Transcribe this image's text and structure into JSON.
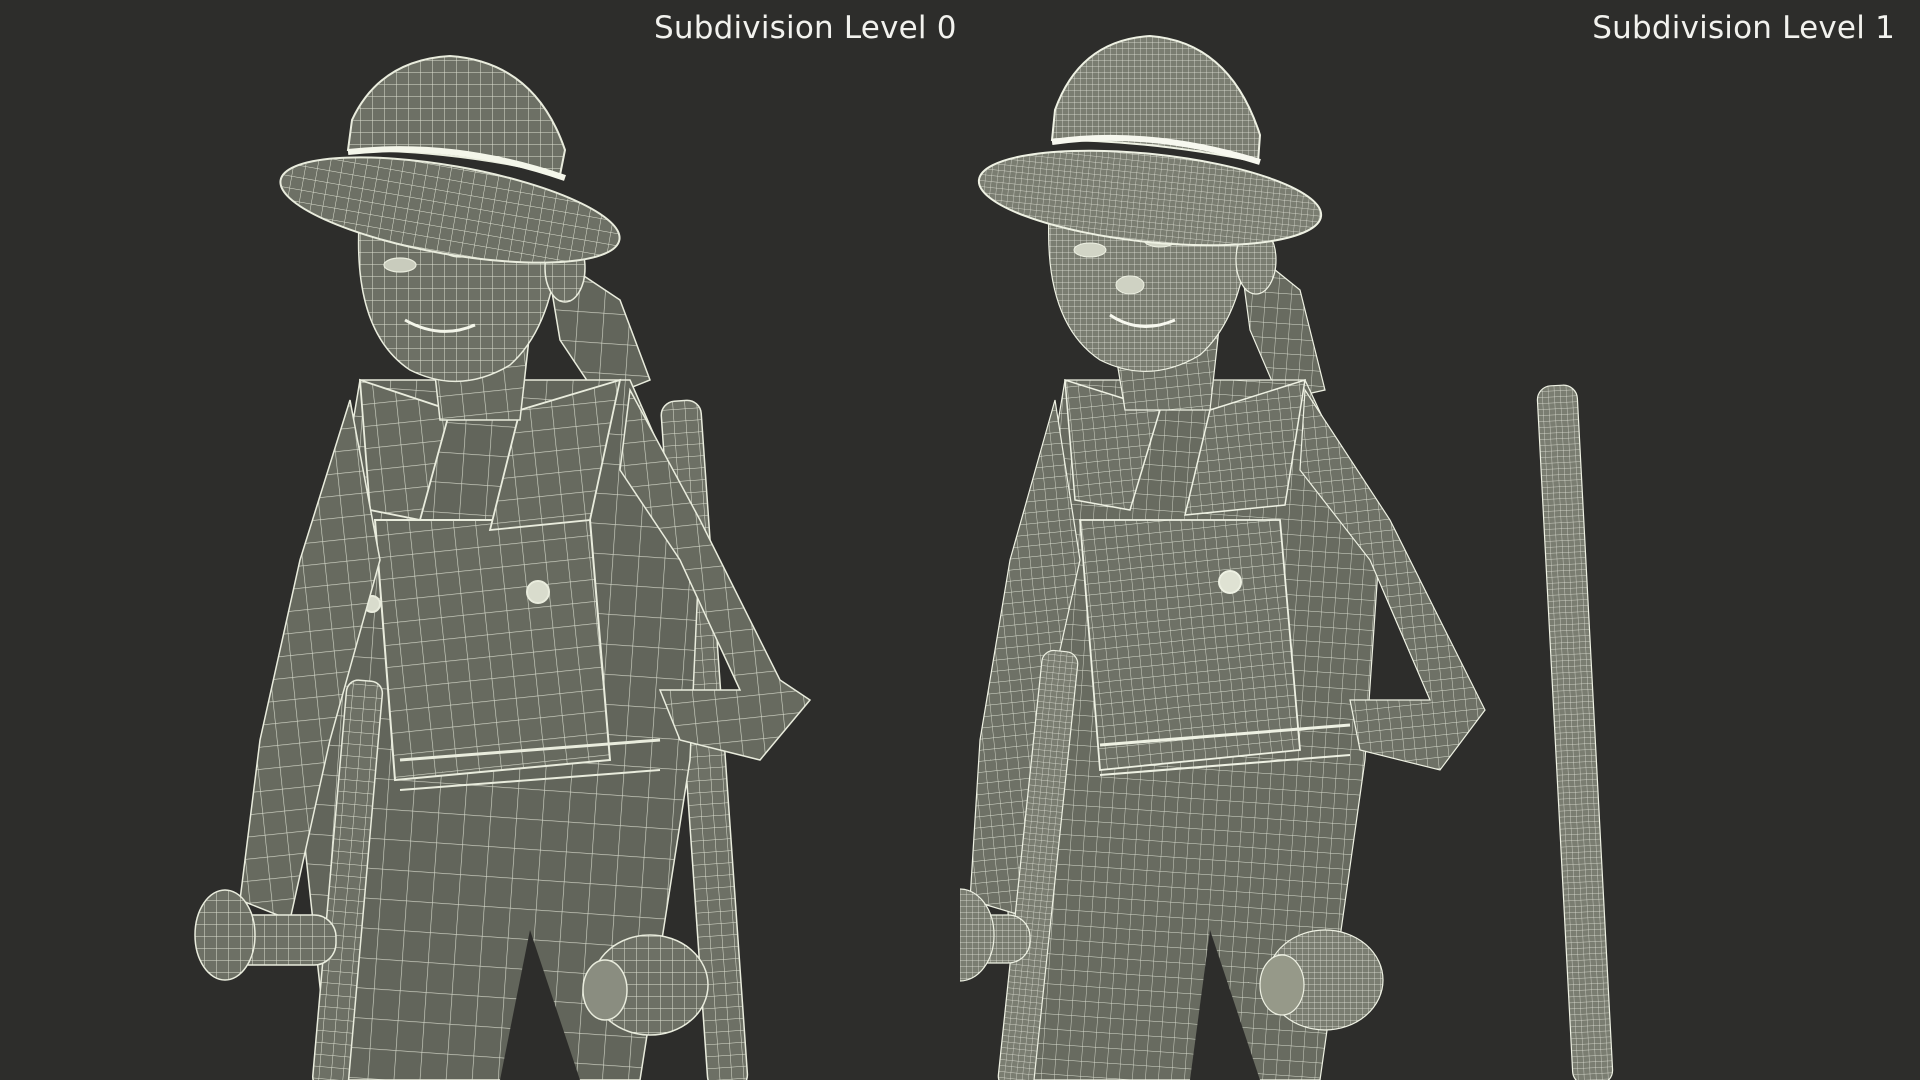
{
  "panels": [
    {
      "label": "Subdivision Level 0"
    },
    {
      "label": "Subdivision Level 1"
    }
  ],
  "colors": {
    "background": "#2d2d2b",
    "mesh_fill": "#676a5f",
    "mesh_shadow": "#4e5149",
    "wire": "#e9ecdd",
    "label": "#f2f2ee"
  },
  "subject": {
    "name": "child-on-crutches-wireframe-icon"
  }
}
